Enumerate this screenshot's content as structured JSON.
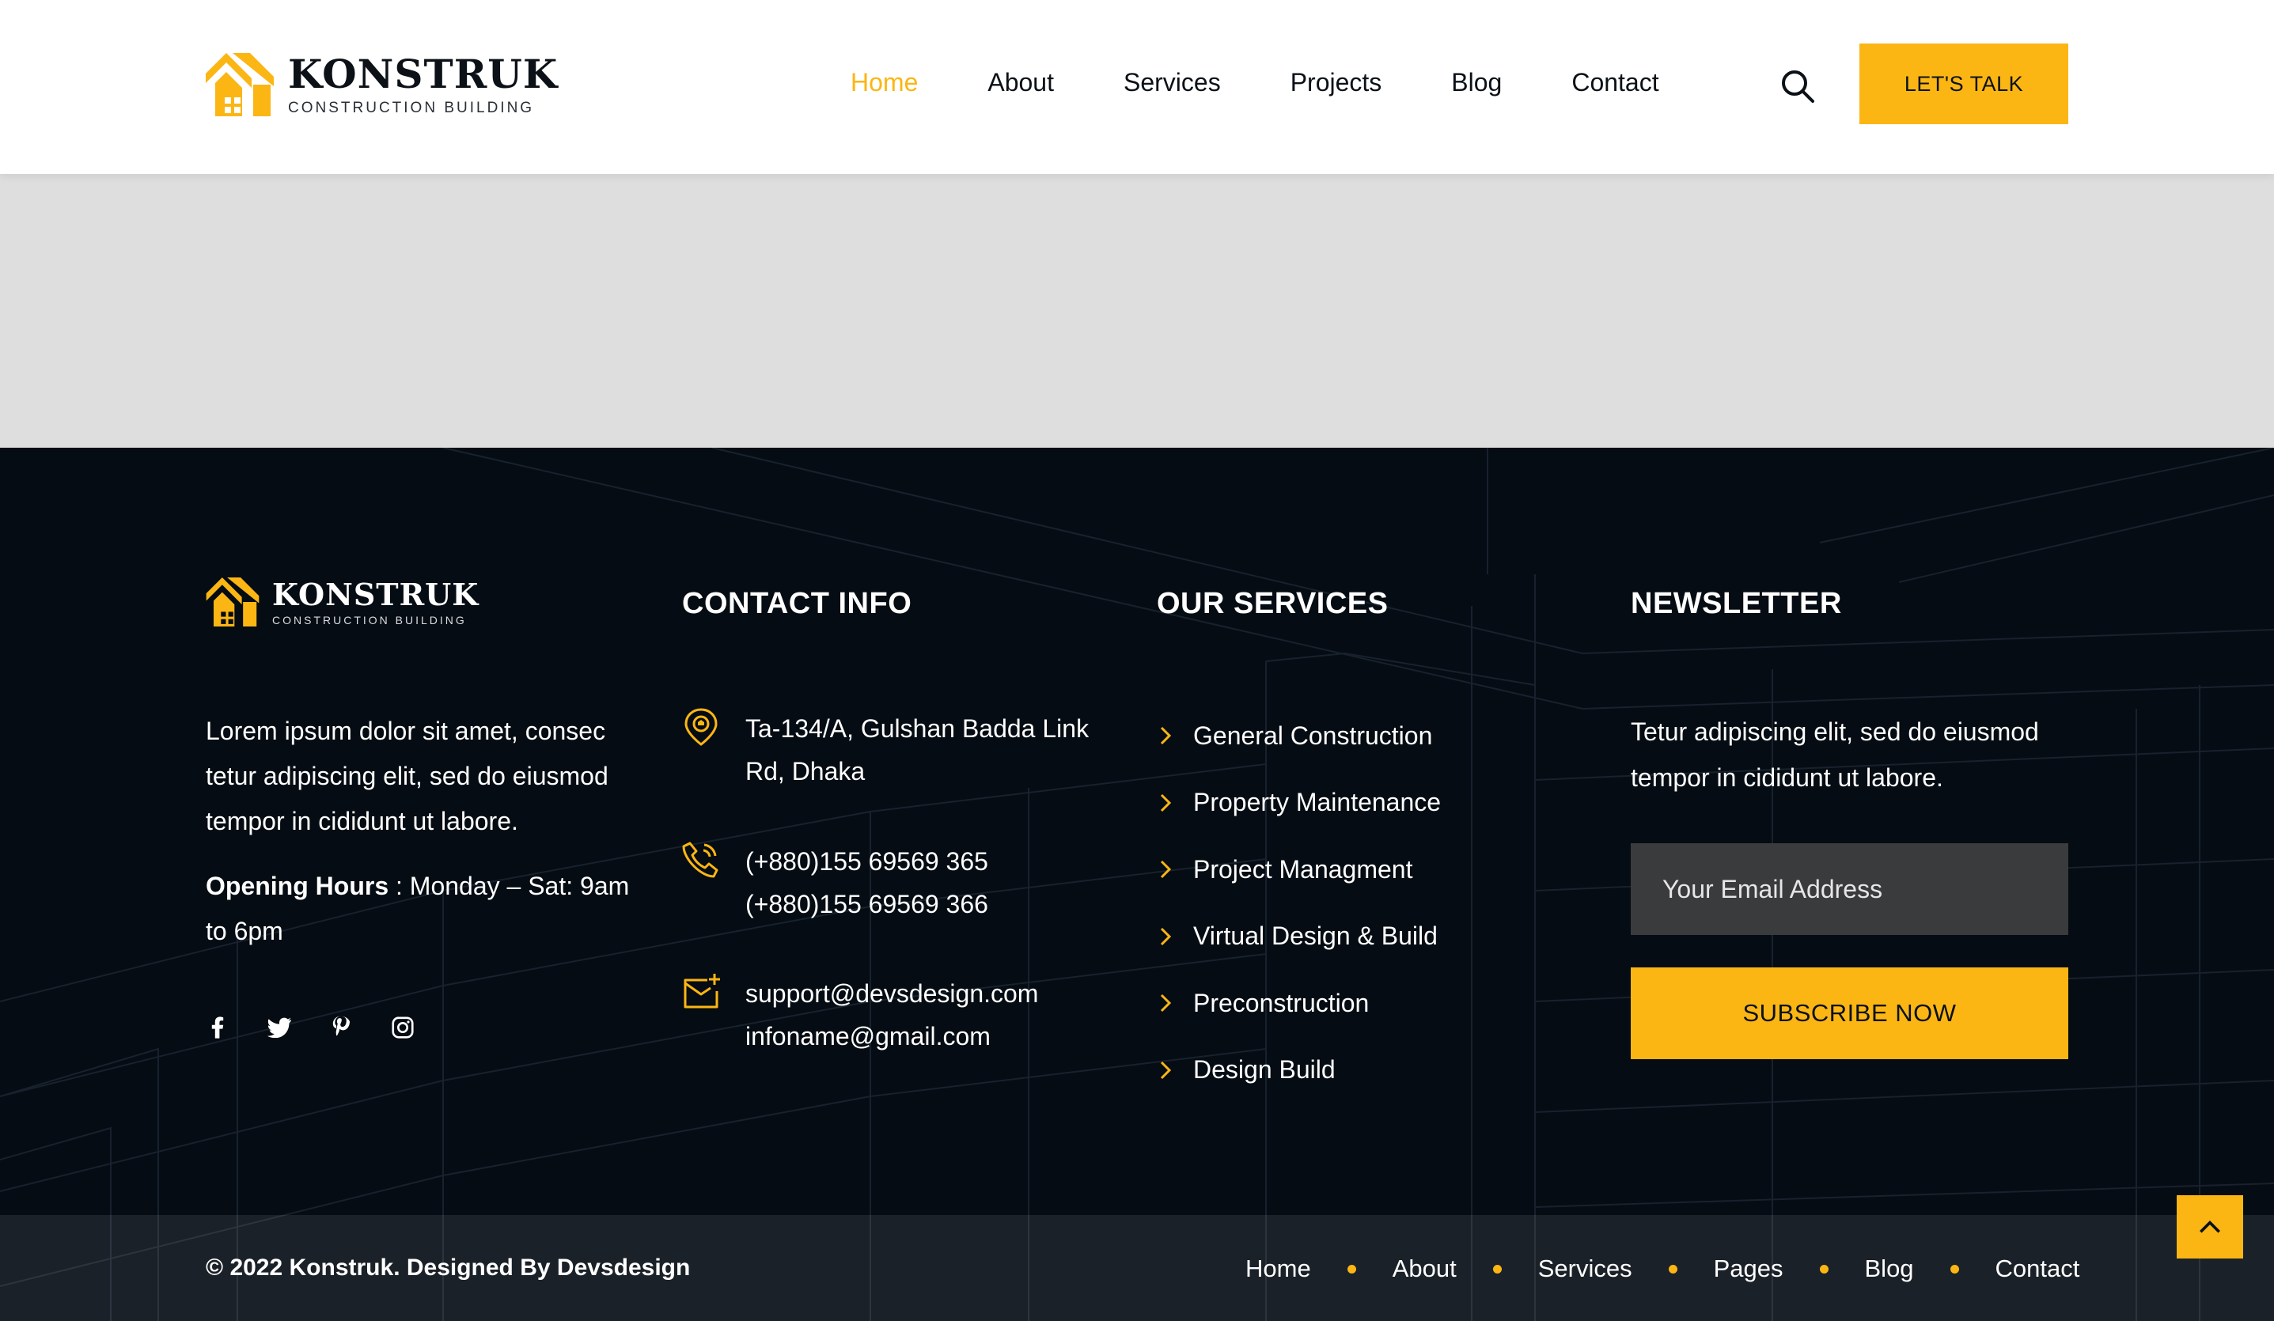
{
  "brand": {
    "name": "KONSTRUK",
    "tagline": "CONSTRUCTION BUILDING",
    "accent_color": "#fbb614",
    "dark_color": "#050c13"
  },
  "header": {
    "nav": [
      {
        "label": "Home",
        "active": true
      },
      {
        "label": "About",
        "active": false
      },
      {
        "label": "Services",
        "active": false
      },
      {
        "label": "Projects",
        "active": false
      },
      {
        "label": "Blog",
        "active": false
      },
      {
        "label": "Contact",
        "active": false
      }
    ],
    "search_icon": "search-icon",
    "cta_label": "LET'S TALK"
  },
  "footer": {
    "about": {
      "text": "Lorem ipsum dolor sit amet, consec tetur adipiscing elit, sed do eiusmod tempor in cididunt ut labore.",
      "hours_label": "Opening Hours",
      "hours_value": " : Monday – Sat: 9am to 6pm",
      "social_icons": [
        "facebook-icon",
        "twitter-icon",
        "pinterest-icon",
        "instagram-icon"
      ]
    },
    "contact": {
      "title": "CONTACT INFO",
      "address": "Ta-134/A, Gulshan Badda Link Rd, Dhaka",
      "phone_1": "(+880)155 69569 365",
      "phone_2": "(+880)155 69569 366",
      "email_1": "support@devsdesign.com",
      "email_2": "infoname@gmail.com"
    },
    "services": {
      "title": "OUR SERVICES",
      "items": [
        "General Construction",
        "Property Maintenance",
        "Project Managment",
        "Virtual Design & Build",
        "Preconstruction",
        "Design Build"
      ]
    },
    "newsletter": {
      "title": "NEWSLETTER",
      "text": "Tetur adipiscing elit, sed do eiusmod tempor in cididunt ut labore.",
      "placeholder": "Your Email Address",
      "button": "SUBSCRIBE NOW"
    },
    "bottom": {
      "copyright": "© 2022 Konstruk. Designed By Devsdesign",
      "links": [
        "Home",
        "About",
        "Services",
        "Pages",
        "Blog",
        "Contact"
      ]
    }
  },
  "scroll_top_icon": "chevron-up-icon"
}
